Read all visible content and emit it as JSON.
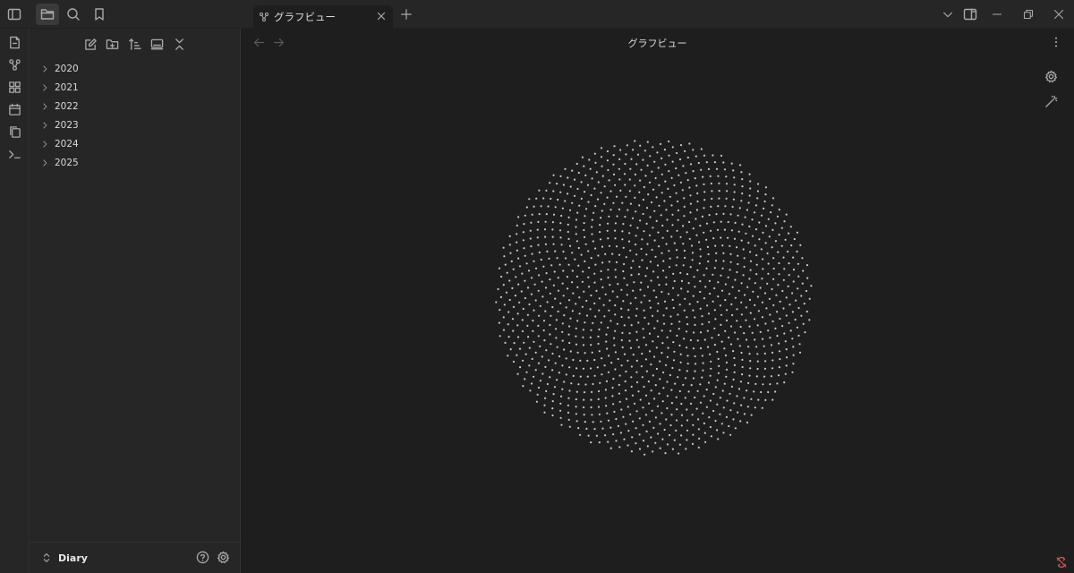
{
  "tab": {
    "title": "グラフビュー"
  },
  "view": {
    "title": "グラフビュー"
  },
  "sidebar": {
    "folders": [
      {
        "label": "2020"
      },
      {
        "label": "2021"
      },
      {
        "label": "2022"
      },
      {
        "label": "2023"
      },
      {
        "label": "2024"
      },
      {
        "label": "2025"
      }
    ]
  },
  "vault": {
    "name": "Diary"
  },
  "graph": {
    "node_color": "#c9c9c9",
    "node_count": 1400
  },
  "icons": {
    "titlebar": [
      "sidebar-toggle-icon",
      "folder-icon",
      "search-icon",
      "bookmark-icon"
    ],
    "ribbon": [
      "file-icon",
      "graph-icon",
      "grid-icon",
      "calendar-icon",
      "copy-icon",
      "terminal-icon"
    ],
    "sidebar_tools": [
      "new-note-icon",
      "new-folder-icon",
      "sort-icon",
      "auto-reveal-icon",
      "collapse-icon"
    ]
  },
  "colors": {
    "accent_sync_error": "#e05555",
    "background": "#1e1e1e",
    "panel": "#262626"
  }
}
